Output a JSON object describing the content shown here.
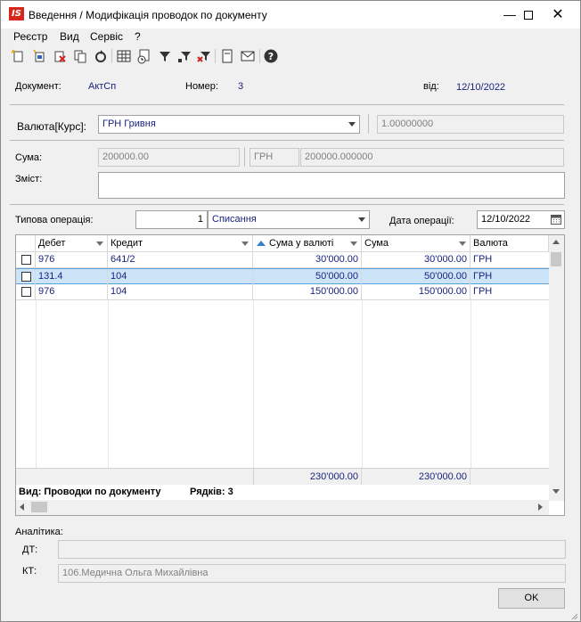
{
  "window": {
    "app_icon_text": "IS",
    "title": "Введення / Модифікація проводок по документу"
  },
  "menu": [
    "Реєстр",
    "Вид",
    "Сервіс",
    "?"
  ],
  "toolbar_icons": [
    "new-icon",
    "new-copy-icon",
    "delete-icon",
    "copy-icon",
    "refresh-icon",
    "table-icon",
    "history-icon",
    "filter-icon",
    "filter-set-icon",
    "filter-clear-icon",
    "document-icon",
    "mail-icon",
    "help-icon"
  ],
  "header": {
    "document_label": "Документ:",
    "document_value": "АктСп",
    "number_label": "Номер:",
    "number_value": "3",
    "date_label": "від:",
    "date_value": "12/10/2022"
  },
  "currency": {
    "label": "Валюта[Курс]:",
    "value": "ГРН Гривня",
    "rate": "1.00000000"
  },
  "sum": {
    "label": "Сума:",
    "value": "200000.00",
    "currency": "ГРН",
    "value2": "200000.000000"
  },
  "content": {
    "label": "Зміст:",
    "value": ""
  },
  "operation": {
    "label": "Типова операція:",
    "code": "1",
    "name": "Списання",
    "date_label": "Дата операції:",
    "date_value": "12/10/2022"
  },
  "grid": {
    "columns": [
      "Дебет",
      "Кредит",
      "Сума у валюті",
      "Сума",
      "Валюта"
    ],
    "rows": [
      {
        "debit": "976",
        "credit": "641/2",
        "sum_cur": "30'000.00",
        "sum": "30'000.00",
        "currency": "ГРН"
      },
      {
        "debit": "131.4",
        "credit": "104",
        "sum_cur": "50'000.00",
        "sum": "50'000.00",
        "currency": "ГРН"
      },
      {
        "debit": "976",
        "credit": "104",
        "sum_cur": "150'000.00",
        "sum": "150'000.00",
        "currency": "ГРН"
      }
    ],
    "total_sum_cur": "230'000.00",
    "total_sum": "230'000.00",
    "view_label": "Вид: Проводки по документу",
    "rows_label": "Рядків: 3"
  },
  "analytics": {
    "label": "Аналітика:",
    "dt_label": "ДТ:",
    "dt_value": "",
    "kt_label": "КТ:",
    "kt_value": "106.Медична Ольга Михайлівна"
  },
  "ok_label": "OK"
}
